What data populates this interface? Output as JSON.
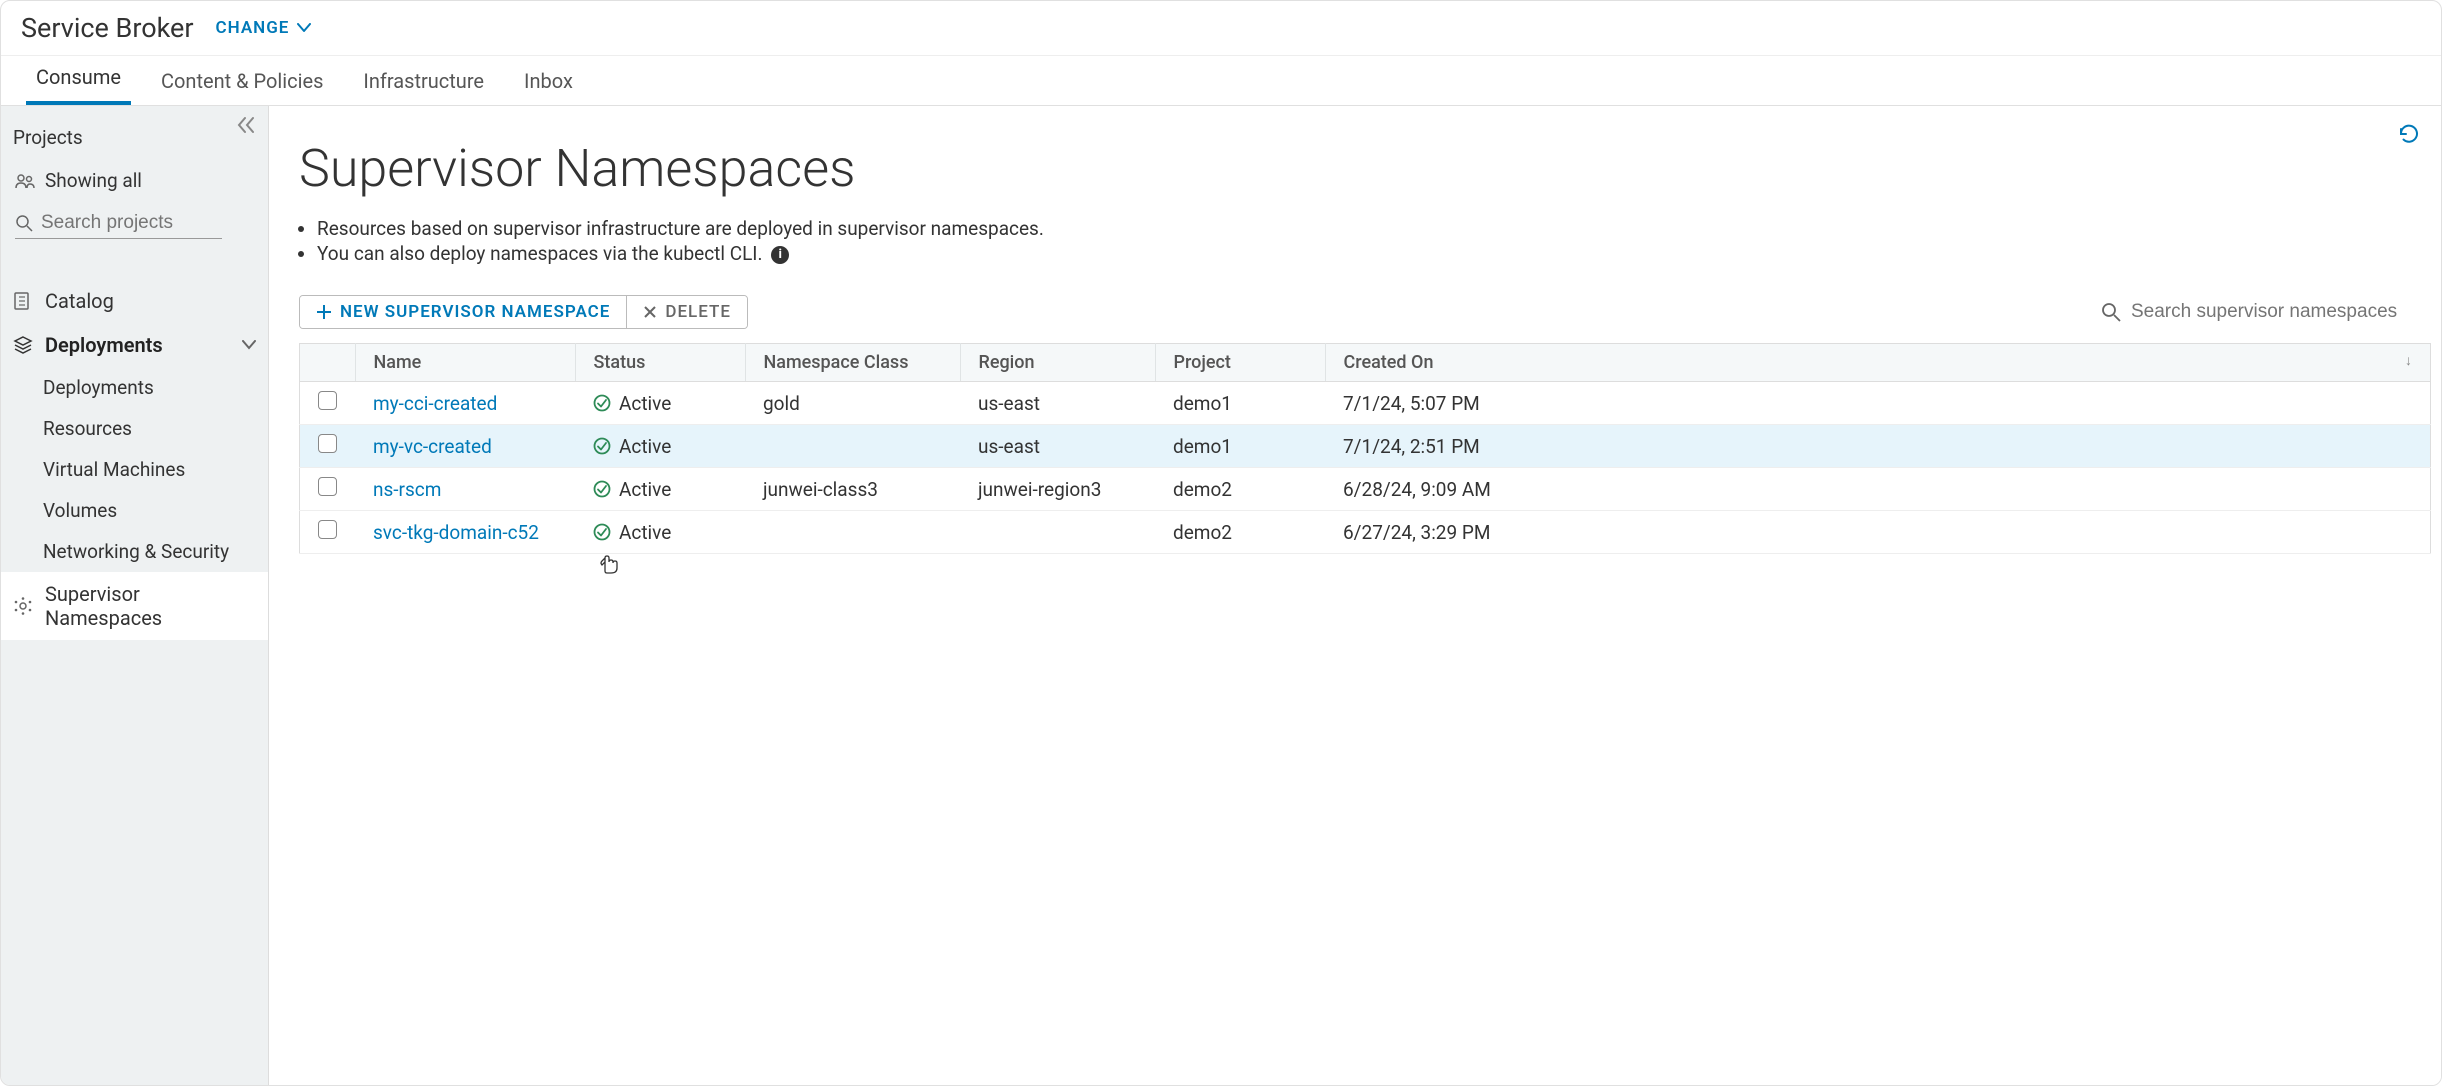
{
  "header": {
    "app_title": "Service Broker",
    "change_label": "CHANGE"
  },
  "tabs": [
    {
      "label": "Consume",
      "active": true
    },
    {
      "label": "Content & Policies",
      "active": false
    },
    {
      "label": "Infrastructure",
      "active": false
    },
    {
      "label": "Inbox",
      "active": false
    }
  ],
  "sidebar": {
    "projects_title": "Projects",
    "showing_all": "Showing all",
    "search_placeholder": "Search projects",
    "catalog": "Catalog",
    "deployments": "Deployments",
    "sub": {
      "deployments": "Deployments",
      "resources": "Resources",
      "vms": "Virtual Machines",
      "volumes": "Volumes",
      "networking": "Networking & Security"
    },
    "supervisor_ns": "Supervisor Namespaces"
  },
  "main": {
    "title": "Supervisor Namespaces",
    "desc1": "Resources based on supervisor infrastructure are deployed in supervisor namespaces.",
    "desc2": "You can also deploy namespaces via the kubectl CLI.",
    "new_btn": "NEW SUPERVISOR NAMESPACE",
    "delete_btn": "DELETE",
    "search_placeholder": "Search supervisor namespaces",
    "columns": {
      "name": "Name",
      "status": "Status",
      "class": "Namespace Class",
      "region": "Region",
      "project": "Project",
      "created": "Created On"
    },
    "rows": [
      {
        "name": "my-cci-created",
        "status": "Active",
        "class": "gold",
        "region": "us-east",
        "project": "demo1",
        "created": "7/1/24, 5:07 PM",
        "highlight": false
      },
      {
        "name": "my-vc-created",
        "status": "Active",
        "class": "",
        "region": "us-east",
        "project": "demo1",
        "created": "7/1/24, 2:51 PM",
        "highlight": true
      },
      {
        "name": "ns-rscm",
        "status": "Active",
        "class": "junwei-class3",
        "region": "junwei-region3",
        "project": "demo2",
        "created": "6/28/24, 9:09 AM",
        "highlight": false
      },
      {
        "name": "svc-tkg-domain-c52",
        "status": "Active",
        "class": "",
        "region": "",
        "project": "demo2",
        "created": "6/27/24, 3:29 PM",
        "highlight": false
      }
    ]
  }
}
